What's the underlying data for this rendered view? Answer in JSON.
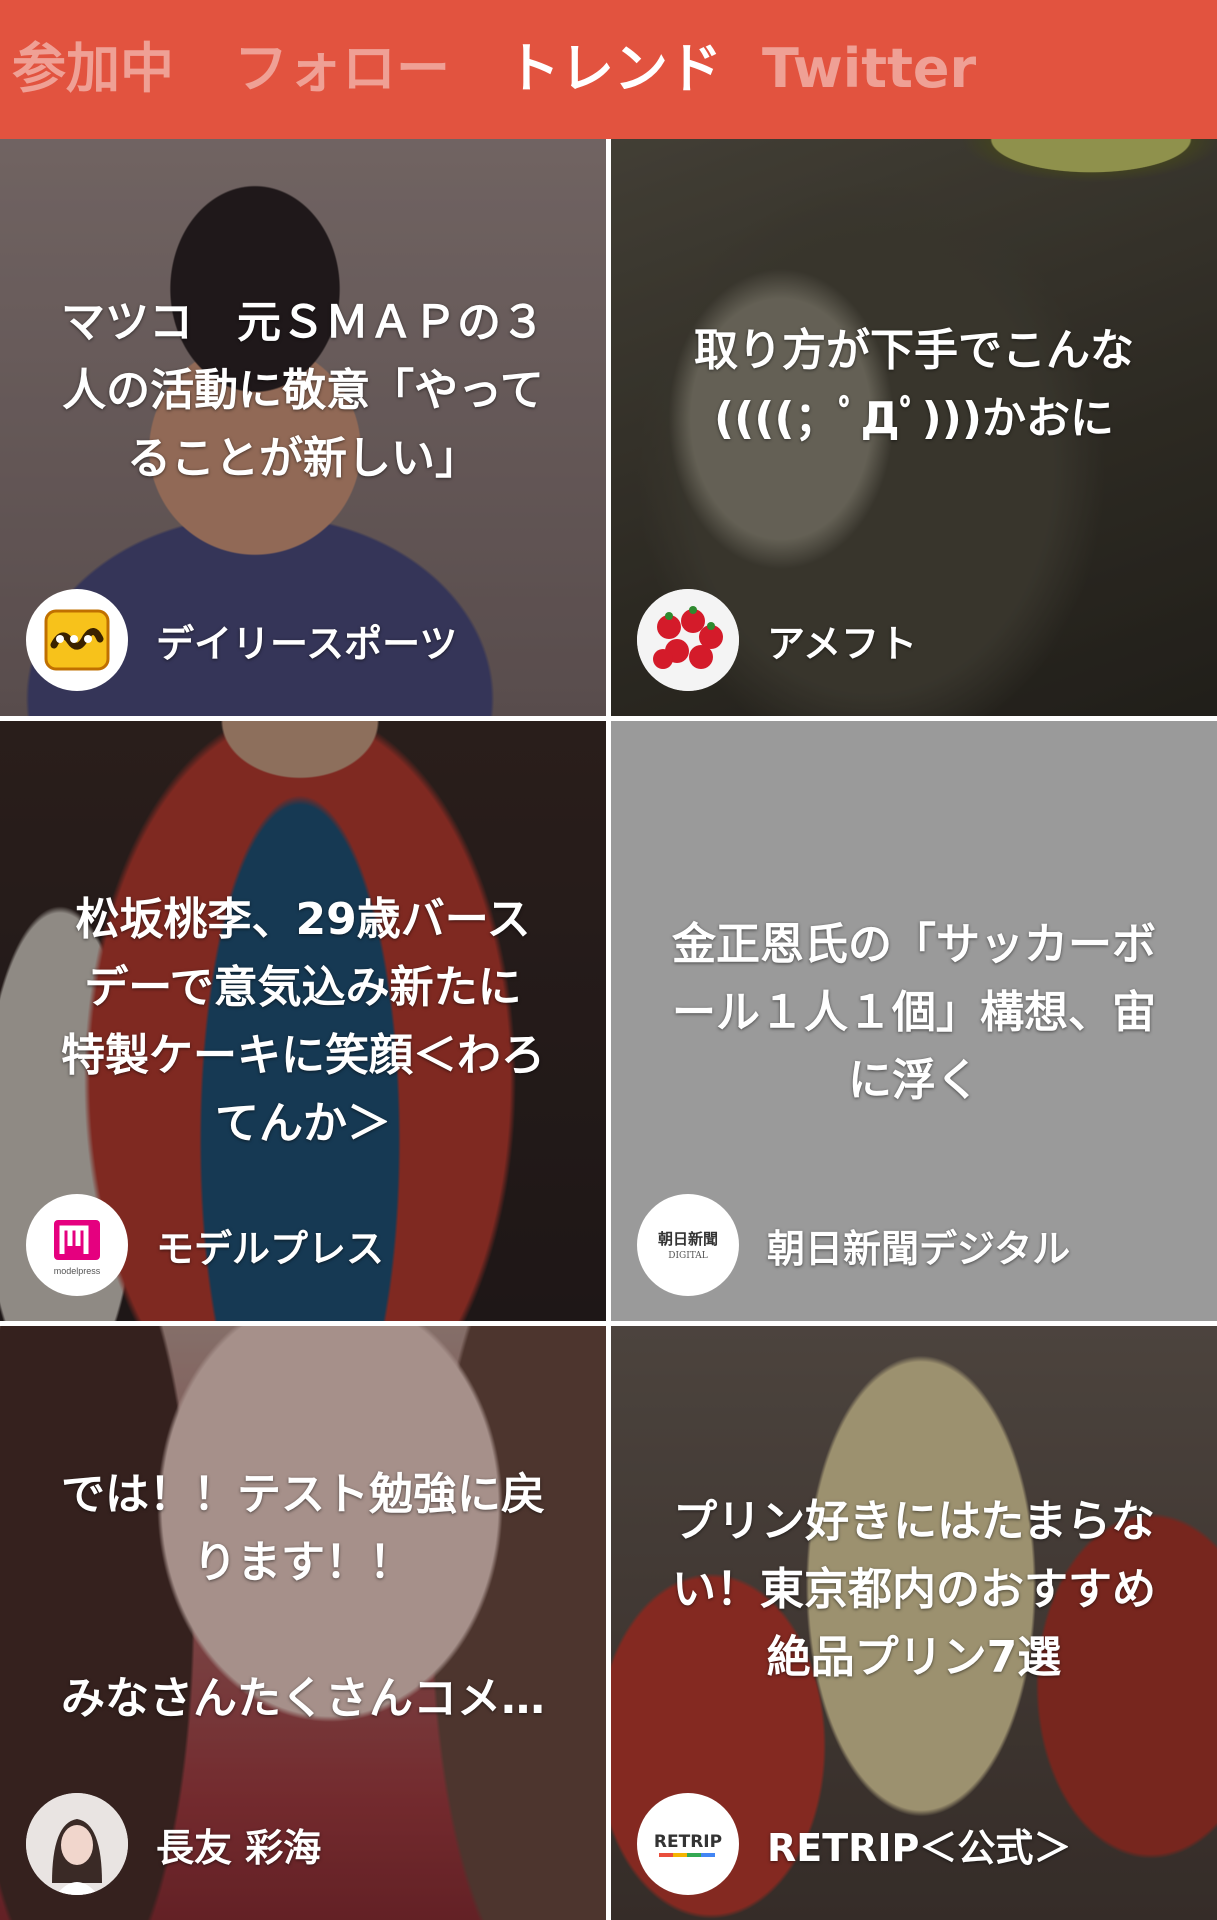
{
  "tabs": [
    {
      "label": "参加中",
      "active": false
    },
    {
      "label": "フォロー",
      "active": false
    },
    {
      "label": "トレンド",
      "active": true
    },
    {
      "label": "Twitter",
      "active": false
    }
  ],
  "cards": [
    {
      "title": "マツコ　元ＳＭＡＰの３\n人の活動に敬意「やって\nることが新しい」",
      "source": "デイリースポーツ",
      "avatar_icon": "daily-sports-logo-icon"
    },
    {
      "title": "取り方が下手でこんな\n((((；ﾟДﾟ)))かおに",
      "source": "アメフト",
      "avatar_icon": "strawberry-avatar-icon"
    },
    {
      "title": "松坂桃李、29歳バース\nデーで意気込み新たに\n特製ケーキに笑顔＜わろ\nてんか＞",
      "source": "モデルプレス",
      "avatar_icon": "modelpress-logo-icon"
    },
    {
      "title": "金正恩氏の「サッカーボ\nール１人１個」構想、宙\nに浮く",
      "source": "朝日新聞デジタル",
      "avatar_icon": "asahi-digital-logo-icon"
    },
    {
      "title": "では！！テスト勉強に戻\nります！！\n\nみなさんたくさんコメ…",
      "source": "長友 彩海",
      "avatar_icon": "user-photo-avatar-icon"
    },
    {
      "title": "プリン好きにはたまらな\nい！東京都内のおすすめ\n絶品プリン7選",
      "source": "RETRIP＜公式＞",
      "avatar_icon": "retrip-logo-icon"
    }
  ],
  "logos": {
    "modelpress_text": "modelpress",
    "asahi_line1": "朝日新聞",
    "asahi_line2": "DIGITAL",
    "retrip_text": "RETRIP"
  },
  "colors": {
    "header_bg": "#e2533f",
    "tab_active": "#ffffff",
    "tab_inactive": "rgba(255,255,255,0.45)",
    "card_plain_bg": "#9a9a9a"
  }
}
